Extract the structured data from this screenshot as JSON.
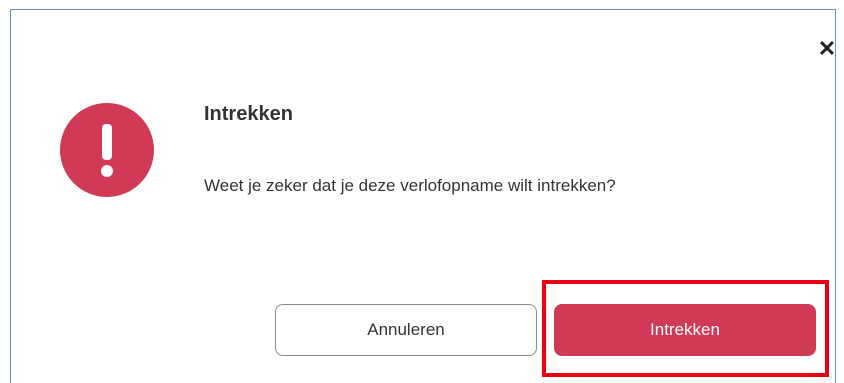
{
  "dialog": {
    "title": "Intrekken",
    "message": "Weet je zeker dat je deze verlofopname wilt intrekken?",
    "close_label": "✕",
    "icon": "exclamation-icon",
    "cancel_label": "Annuleren",
    "confirm_label": "Intrekken"
  },
  "colors": {
    "accent": "#d13a56",
    "highlight": "#e60012",
    "dialog_border": "#6a8fc2"
  }
}
